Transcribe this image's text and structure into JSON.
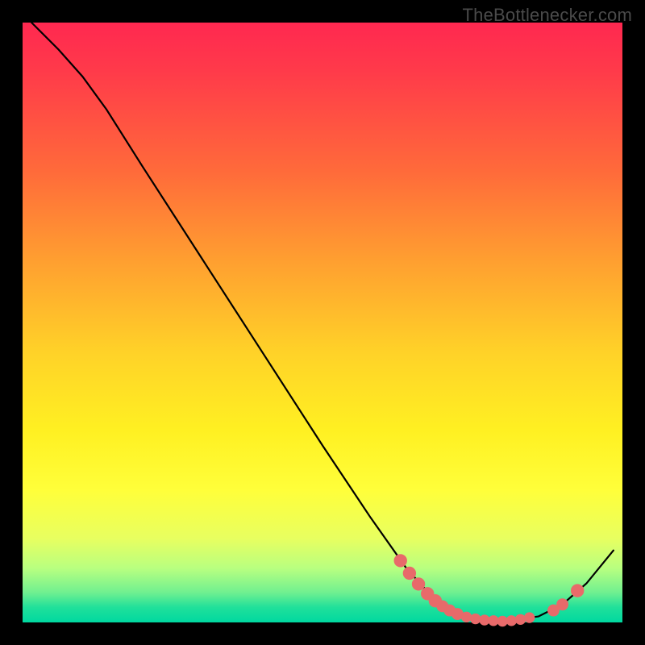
{
  "watermark": "TheBottlenecker.com",
  "chart_data": {
    "type": "line",
    "title": "",
    "xlabel": "",
    "ylabel": "",
    "xlim": [
      0,
      100
    ],
    "ylim": [
      0,
      100
    ],
    "grid": false,
    "curve_points": [
      {
        "x": 1.5,
        "y": 100.0
      },
      {
        "x": 6.0,
        "y": 95.5
      },
      {
        "x": 10.0,
        "y": 91.0
      },
      {
        "x": 14.0,
        "y": 85.5
      },
      {
        "x": 20.0,
        "y": 76.0
      },
      {
        "x": 30.0,
        "y": 60.5
      },
      {
        "x": 40.0,
        "y": 45.0
      },
      {
        "x": 50.0,
        "y": 29.5
      },
      {
        "x": 58.0,
        "y": 17.5
      },
      {
        "x": 64.0,
        "y": 9.0
      },
      {
        "x": 69.0,
        "y": 3.5
      },
      {
        "x": 74.0,
        "y": 0.8
      },
      {
        "x": 80.0,
        "y": 0.2
      },
      {
        "x": 86.0,
        "y": 1.0
      },
      {
        "x": 90.0,
        "y": 3.0
      },
      {
        "x": 94.0,
        "y": 6.5
      },
      {
        "x": 98.5,
        "y": 12.0
      }
    ],
    "markers": [
      {
        "x": 63.0,
        "y": 10.3,
        "r": 1.1
      },
      {
        "x": 64.5,
        "y": 8.2,
        "r": 1.1
      },
      {
        "x": 66.0,
        "y": 6.4,
        "r": 1.1
      },
      {
        "x": 67.5,
        "y": 4.8,
        "r": 1.1
      },
      {
        "x": 68.8,
        "y": 3.6,
        "r": 1.1
      },
      {
        "x": 70.0,
        "y": 2.7,
        "r": 1.0
      },
      {
        "x": 71.2,
        "y": 2.0,
        "r": 1.0
      },
      {
        "x": 72.5,
        "y": 1.4,
        "r": 1.0
      },
      {
        "x": 74.0,
        "y": 0.9,
        "r": 0.9
      },
      {
        "x": 75.5,
        "y": 0.6,
        "r": 0.9
      },
      {
        "x": 77.0,
        "y": 0.4,
        "r": 0.9
      },
      {
        "x": 78.5,
        "y": 0.3,
        "r": 0.9
      },
      {
        "x": 80.0,
        "y": 0.2,
        "r": 0.9
      },
      {
        "x": 81.5,
        "y": 0.3,
        "r": 0.9
      },
      {
        "x": 83.0,
        "y": 0.5,
        "r": 0.9
      },
      {
        "x": 84.5,
        "y": 0.8,
        "r": 0.9
      },
      {
        "x": 88.5,
        "y": 2.0,
        "r": 1.0
      },
      {
        "x": 90.0,
        "y": 3.0,
        "r": 1.0
      },
      {
        "x": 92.5,
        "y": 5.3,
        "r": 1.1
      }
    ],
    "curve_color": "#000000",
    "marker_color": "#e86a6a"
  }
}
